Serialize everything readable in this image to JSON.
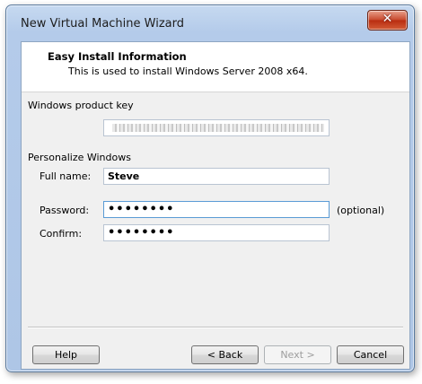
{
  "window": {
    "title": "New Virtual Machine Wizard",
    "close_glyph": "✕"
  },
  "header": {
    "title": "Easy Install Information",
    "subtitle": "This is used to install Windows Server 2008 x64."
  },
  "product_key": {
    "section_label": "Windows product key"
  },
  "personalize": {
    "section_label": "Personalize Windows",
    "full_name_label": "Full name:",
    "full_name_value": "Steve",
    "password_label": "Password:",
    "password_value": "••••••••",
    "optional_note": "(optional)",
    "confirm_label": "Confirm:",
    "confirm_value": "••••••••"
  },
  "buttons": {
    "help": "Help",
    "back": "< Back",
    "next": "Next >",
    "cancel": "Cancel"
  },
  "colors": {
    "title_bar": "#b4cbea",
    "close_button": "#c7472b",
    "focus_border": "#5a9bd5"
  }
}
